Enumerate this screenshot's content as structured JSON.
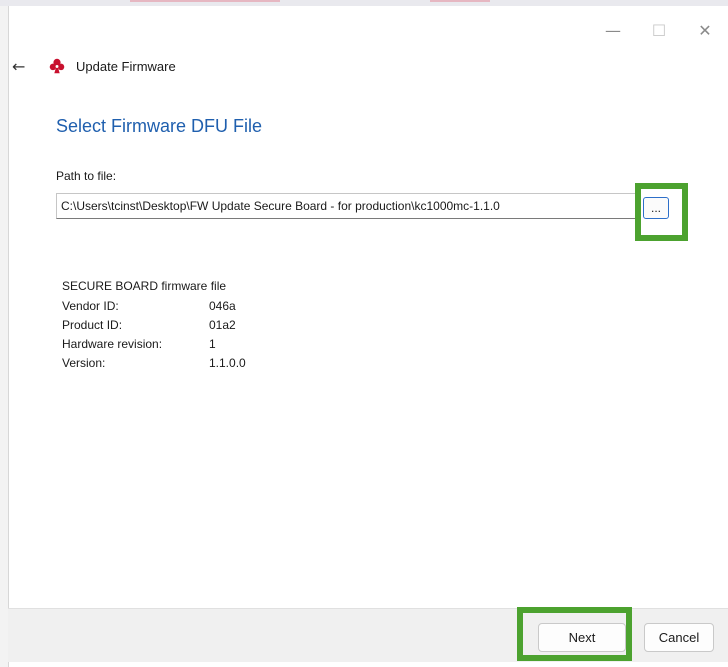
{
  "window": {
    "title": "Update Firmware",
    "controls": {
      "minimize": "—",
      "maximize": "☐",
      "close": "✕"
    },
    "back_glyph": "←"
  },
  "page": {
    "title": "Select Firmware DFU File",
    "path_label": "Path to file:",
    "path_value": "C:\\Users\\tcinst\\Desktop\\FW Update Secure Board - for production\\kc1000mc-1.1.0",
    "browse_label": "..."
  },
  "file_info": {
    "heading": "SECURE BOARD firmware file",
    "rows": [
      {
        "label": "Vendor ID:",
        "value": "046a"
      },
      {
        "label": "Product ID:",
        "value": "01a2"
      },
      {
        "label": "Hardware revision:",
        "value": "1"
      },
      {
        "label": "Version:",
        "value": "1.1.0.0"
      }
    ]
  },
  "footer": {
    "next_label": "Next",
    "cancel_label": "Cancel"
  },
  "icons": [
    "back-arrow-icon",
    "app-logo-icon",
    "minimize-icon",
    "maximize-icon",
    "close-icon"
  ],
  "colors": {
    "title_blue": "#1f5fae",
    "highlight_green": "#4ca22f",
    "focus_blue": "#2d6fc9"
  }
}
